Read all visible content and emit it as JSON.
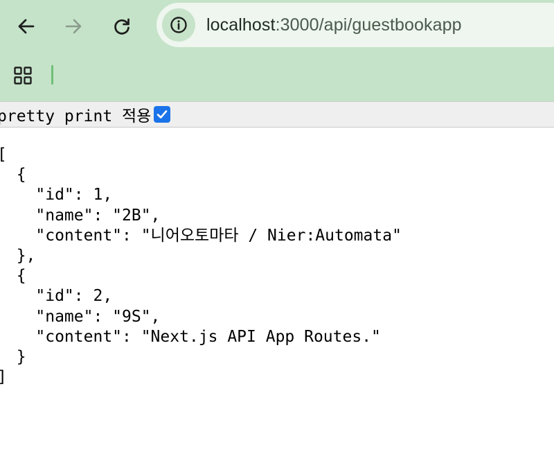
{
  "browser": {
    "address_bar": {
      "url_host": "localhost",
      "url_rest": ":3000/api/guestbookapp"
    },
    "icons": {
      "back": "arrow-left-icon",
      "forward": "arrow-right-icon",
      "reload": "reload-icon",
      "site_info": "info-circle-icon",
      "apps": "apps-grid-icon"
    }
  },
  "pretty_print": {
    "label": "pretty print 적용",
    "checked": true
  },
  "json_lines": [
    "[",
    "  {",
    "    \"id\": 1,",
    "    \"name\": \"2B\",",
    "    \"content\": \"니어오토마타 / Nier:Automata\"",
    "  },",
    "  {",
    "    \"id\": 2,",
    "    \"name\": \"9S\",",
    "    \"content\": \"Next.js API App Routes.\"",
    "  }",
    "]"
  ],
  "colors": {
    "chrome_background": "#c5e3c8",
    "address_bar_background": "#eef6ef",
    "site_info_background": "#c7e3c9",
    "checkbox_accent": "#1a73e8"
  }
}
